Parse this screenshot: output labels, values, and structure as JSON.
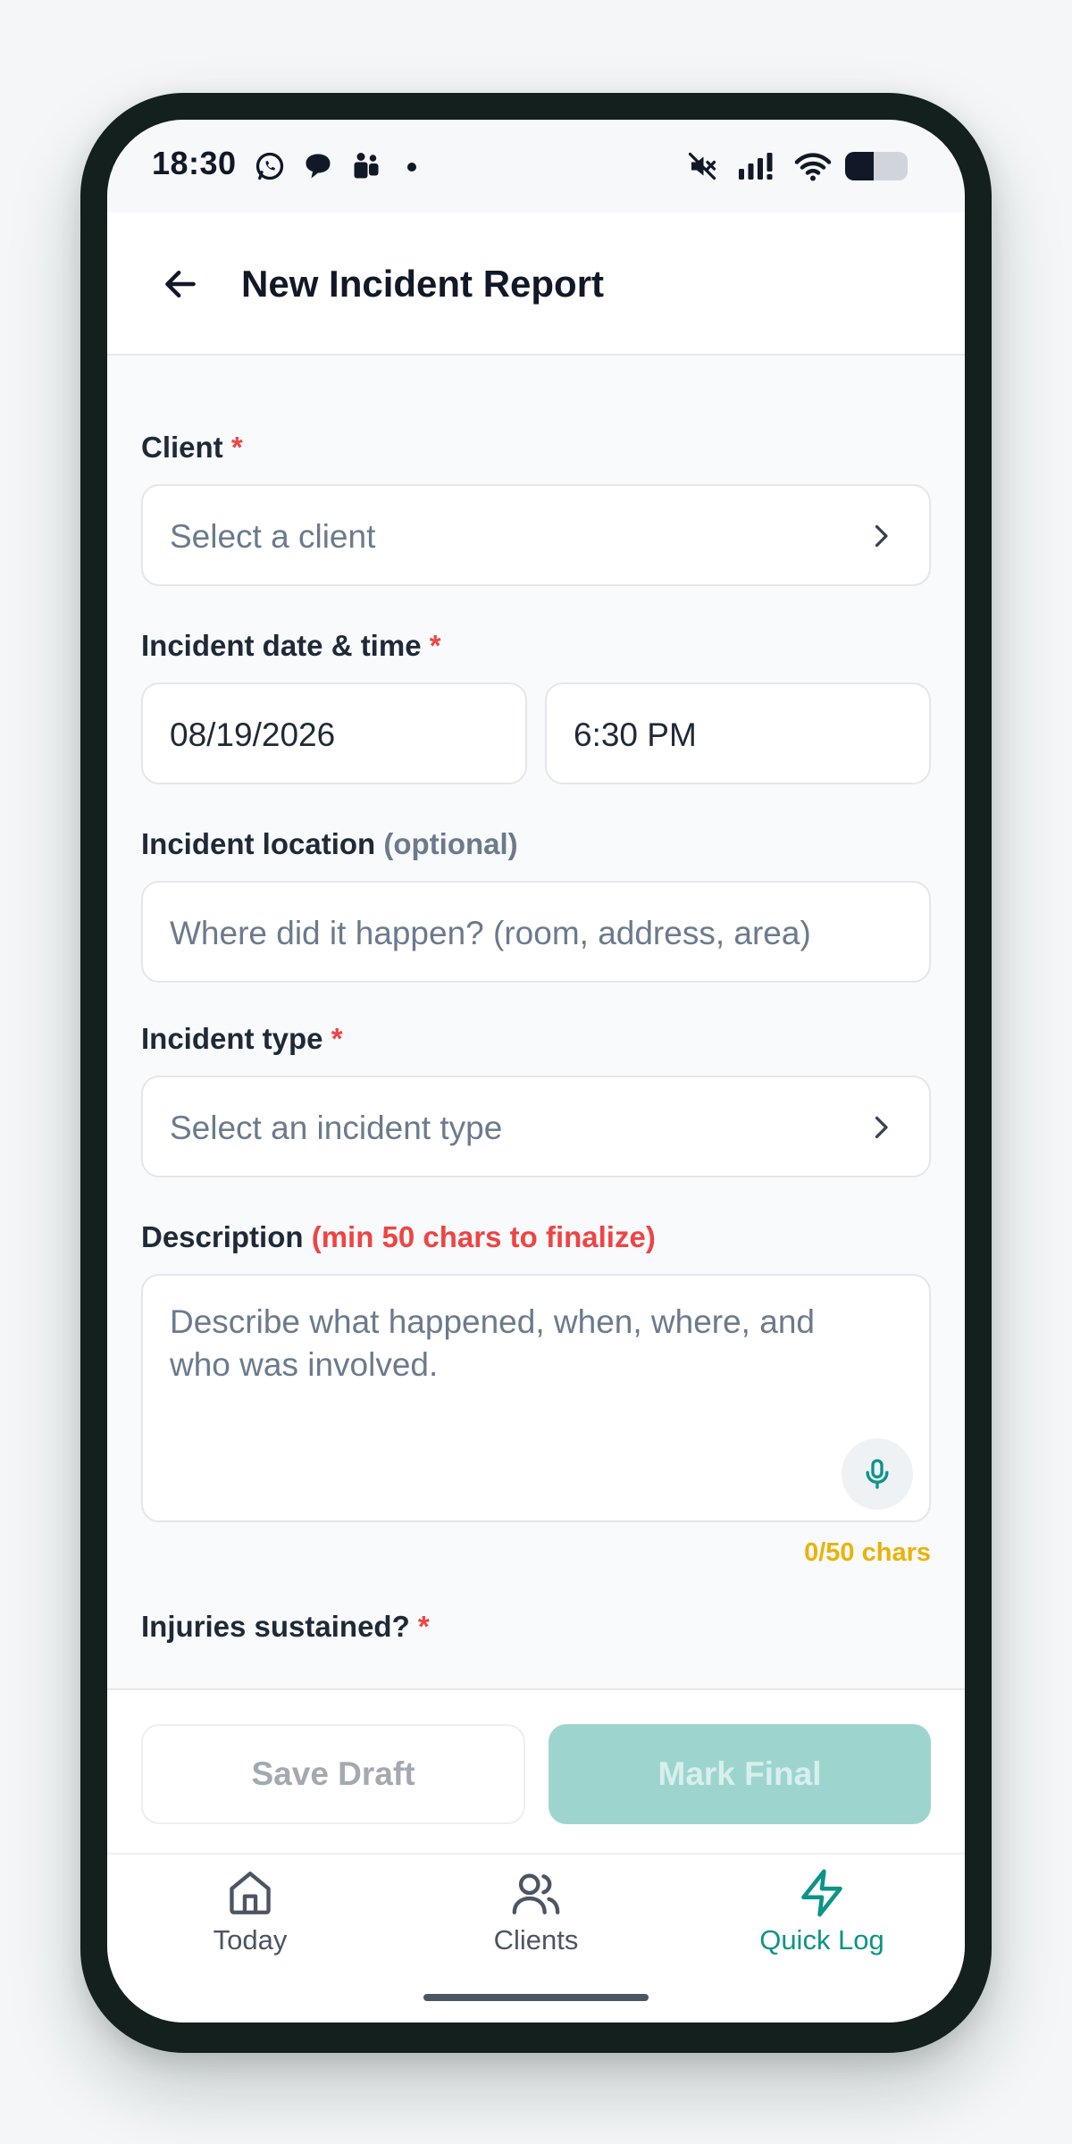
{
  "status_bar": {
    "time": "18:30",
    "icons_left": [
      "whatsapp-icon",
      "chat-bubble-icon",
      "teams-icon",
      "dot-icon"
    ],
    "icons_right": [
      "mute-icon",
      "signal-icon",
      "wifi-icon",
      "battery-icon"
    ],
    "battery_level": 0.45
  },
  "header": {
    "title": "New Incident Report"
  },
  "form": {
    "client": {
      "label": "Client",
      "required_mark": "*",
      "placeholder": "Select a client"
    },
    "datetime": {
      "label": "Incident date & time",
      "required_mark": "*",
      "date": "08/19/2026",
      "time": "6:30 PM"
    },
    "location": {
      "label": "Incident location",
      "optional_note": "(optional)",
      "placeholder": "Where did it happen? (room, address, area)"
    },
    "incident_type": {
      "label": "Incident type",
      "required_mark": "*",
      "placeholder": "Select an incident type"
    },
    "description": {
      "label": "Description",
      "hint": "(min 50 chars to finalize)",
      "placeholder": "Describe what happened, when, where, and who was involved.",
      "counter": "0/50 chars"
    },
    "injuries": {
      "label": "Injuries sustained?",
      "required_mark": "*"
    }
  },
  "actions": {
    "save_draft": "Save Draft",
    "mark_final": "Mark Final"
  },
  "tabbar": {
    "items": [
      {
        "label": "Today",
        "icon": "home-icon"
      },
      {
        "label": "Clients",
        "icon": "users-icon"
      },
      {
        "label": "Quick Log",
        "icon": "lightning-icon"
      }
    ],
    "active": "Quick Log"
  },
  "colors": {
    "accent": "#0d9488",
    "required": "#ef4444",
    "counter": "#eab308",
    "disabled_primary": "#9dd5ce"
  }
}
